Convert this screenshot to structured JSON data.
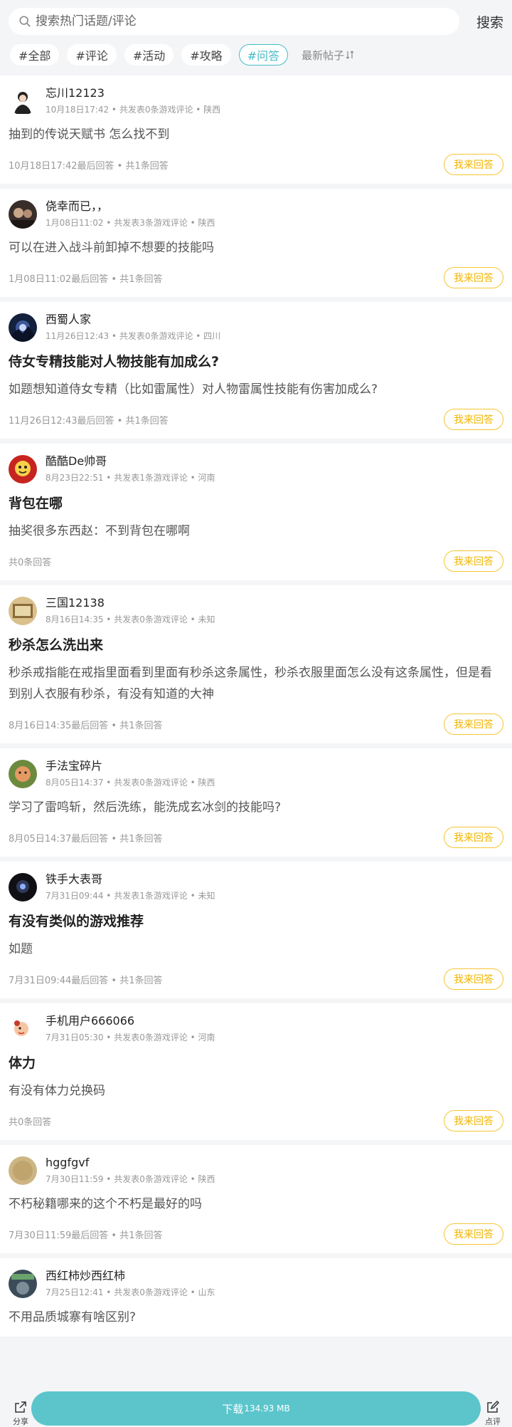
{
  "search": {
    "placeholder": "搜索热门话题/评论",
    "button": "搜索"
  },
  "tags": [
    {
      "label": "#全部"
    },
    {
      "label": "#评论"
    },
    {
      "label": "#活动"
    },
    {
      "label": "#攻略"
    },
    {
      "label": "#问答"
    }
  ],
  "sort_label": "最新帖子",
  "answer_label": "我来回答",
  "posts": [
    {
      "user": "忘川12123",
      "meta": "10月18日17:42 • 共发表0条游戏评论 • 陕西",
      "title": "",
      "body": "抽到的传说天赋书 怎么找不到",
      "foot": "10月18日17:42最后回答 • 共1条回答"
    },
    {
      "user": "侥幸而已，，",
      "meta": "1月08日11:02 • 共发表3条游戏评论 • 陕西",
      "title": "",
      "body": "可以在进入战斗前卸掉不想要的技能吗",
      "foot": "1月08日11:02最后回答 • 共1条回答"
    },
    {
      "user": "西蜀人家",
      "meta": "11月26日12:43 • 共发表0条游戏评论 • 四川",
      "title": "侍女专精技能对人物技能有加成么?",
      "body": "如题想知道侍女专精（比如雷属性）对人物雷属性技能有伤害加成么?",
      "foot": "11月26日12:43最后回答 • 共1条回答"
    },
    {
      "user": "酷酷De帅哥",
      "meta": "8月23日22:51 • 共发表1条游戏评论 • 河南",
      "title": "背包在哪",
      "body": "抽奖很多东西赵：不到背包在哪啊",
      "foot": "共0条回答"
    },
    {
      "user": "三国12138",
      "meta": "8月16日14:35 • 共发表0条游戏评论 • 未知",
      "title": "秒杀怎么洗出来",
      "body": "秒杀戒指能在戒指里面看到里面有秒杀这条属性，秒杀衣服里面怎么没有这条属性，但是看到别人衣服有秒杀，有没有知道的大神",
      "foot": "8月16日14:35最后回答 • 共1条回答"
    },
    {
      "user": "手法宝碎片",
      "meta": "8月05日14:37 • 共发表0条游戏评论 • 陕西",
      "title": "",
      "body": "学习了雷鸣斩，然后洗练，能洗成玄冰剑的技能吗?",
      "foot": "8月05日14:37最后回答 • 共1条回答"
    },
    {
      "user": "铁手大表哥",
      "meta": "7月31日09:44 • 共发表1条游戏评论 • 未知",
      "title": "有没有类似的游戏推荐",
      "body": "如题",
      "foot": "7月31日09:44最后回答 • 共1条回答"
    },
    {
      "user": "手机用户666066",
      "meta": "7月31日05:30 • 共发表0条游戏评论 • 河南",
      "title": "体力",
      "body": "有没有体力兑换码",
      "foot": "共0条回答"
    },
    {
      "user": "hggfgvf",
      "meta": "7月30日11:59 • 共发表0条游戏评论 • 陕西",
      "title": "",
      "body": "不朽秘籍哪来的这个不朽是最好的吗",
      "foot": "7月30日11:59最后回答 • 共1条回答"
    },
    {
      "user": "西红柿炒西红柿",
      "meta": "7月25日12:41 • 共发表0条游戏评论 • 山东",
      "title": "",
      "body": "不用品质城寨有啥区别?",
      "foot": ""
    }
  ],
  "bottom": {
    "share": "分享",
    "download": "下载",
    "size": "134.93 MB",
    "review": "点评"
  },
  "colors": {
    "accent": "#45bcc6",
    "answer": "#f5c533",
    "download": "#5cc5cc"
  },
  "icons": {
    "search": "search-icon",
    "sort": "sort-icon",
    "share": "share-icon",
    "review": "edit-icon"
  }
}
